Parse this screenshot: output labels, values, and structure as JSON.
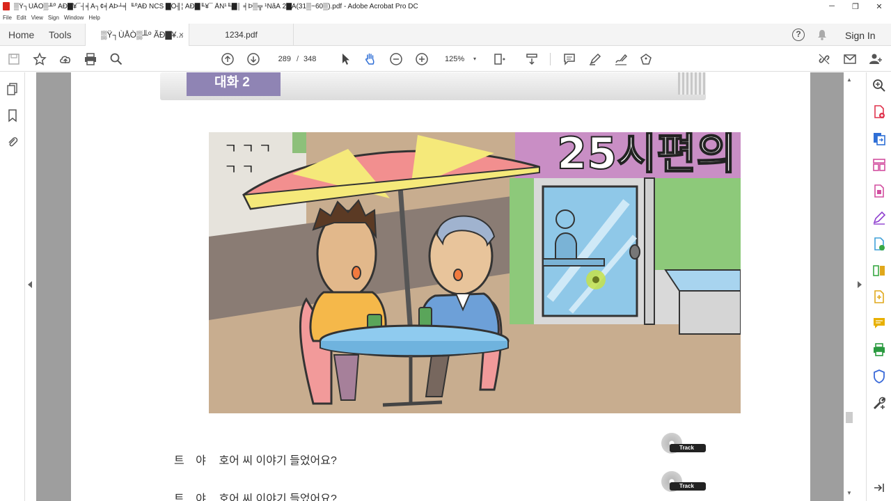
{
  "window": {
    "title": "▒Ÿ┐ÙÅÒ▒╨º ÃÐ▇¥¯┤╡Â┐¢╡ÃÞ┴╡ ╙ºÃÐ NCS ▇Ö╢¦ ÃÐ▇╙¥¯ ÅÑ¹╙▇│ ╡Þ▒╦ ¹ÑãÃ 2▇Ã(31▒~60▒).pdf - Adobe Acrobat Pro DC",
    "minimize": "─",
    "restore": "❐",
    "close": "✕"
  },
  "menu": [
    "File",
    "Edit",
    "View",
    "Sign",
    "Window",
    "Help"
  ],
  "tabs": {
    "home": "Home",
    "tools": "Tools",
    "doc_active": "▒Ÿ┐ÙÅÒ▒╨º ÃÐ▇¥...",
    "doc_active_close": "×",
    "doc_second": "1234.pdf",
    "sign_in": "Sign In"
  },
  "toolbar": {
    "page_current": "289",
    "page_sep": "/",
    "page_total": "348",
    "zoom": "125%",
    "zoom_caret": "▾"
  },
  "document": {
    "section_label": "대화 2",
    "dialogue": [
      {
        "speaker": "트 야",
        "text": "호어 씨 이야기 들었어요?"
      },
      {
        "speaker": "트 야",
        "text": "호어 씨 이야기 들었어요?"
      }
    ],
    "track_label": "Track",
    "store_sign": "25시편의"
  },
  "colors": {
    "ribbon_label": "#8f84b4",
    "acrobat_red": "#d9261c",
    "right_panel_accents": [
      "#e0334d",
      "#2f6fd6",
      "#d24fa0",
      "#8e3fcf",
      "#3fa0d8",
      "#39a845",
      "#e0a81c",
      "#e8b000",
      "#2a9a3f",
      "#3a6ad9",
      "#444444"
    ]
  },
  "scrollbar": {
    "up": "▲",
    "down": "▼"
  }
}
